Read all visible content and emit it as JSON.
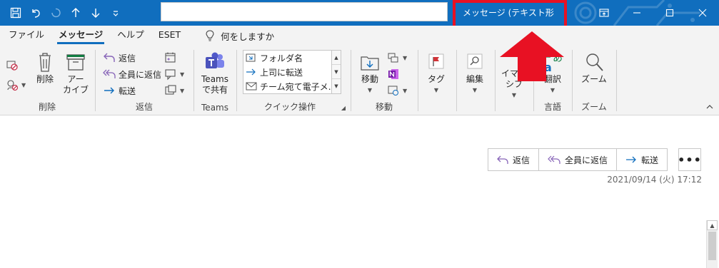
{
  "window": {
    "title": "メッセージ (テキスト形式)",
    "search_value": ""
  },
  "tabs": [
    {
      "label": "ファイル"
    },
    {
      "label": "メッセージ"
    },
    {
      "label": "ヘルプ"
    },
    {
      "label": "ESET"
    }
  ],
  "tell_me": "何をしますか",
  "ribbon": {
    "delete_group": {
      "label": "削除",
      "delete": "削除",
      "archive_line1": "アー",
      "archive_line2": "カイブ"
    },
    "respond_group": {
      "label": "返信",
      "reply": "返信",
      "reply_all": "全員に返信",
      "forward": "転送"
    },
    "teams_group": {
      "label": "Teams",
      "share_line1": "Teams",
      "share_line2": "で共有"
    },
    "quick_group": {
      "label": "クイック操作",
      "items": [
        "フォルダ名",
        "上司に転送",
        "チーム宛て電子メ…"
      ]
    },
    "move_group": {
      "label": "移動",
      "move": "移動"
    },
    "tags_group": {
      "tag": "タグ"
    },
    "edit_group": {
      "edit": "編集"
    },
    "immersive_group": {
      "line1": "イマー",
      "line2": "シブ"
    },
    "language_group": {
      "label": "言語",
      "translate": "翻訳"
    },
    "zoom_group": {
      "label": "ズーム",
      "zoom": "ズーム"
    }
  },
  "message": {
    "reply": "返信",
    "reply_all": "全員に返信",
    "forward": "転送",
    "more": "•••",
    "date": "2021/09/14 (火) 17:12"
  },
  "colors": {
    "titlebar": "#106ebe",
    "highlight": "#e81123",
    "accent": "#106ebe"
  }
}
